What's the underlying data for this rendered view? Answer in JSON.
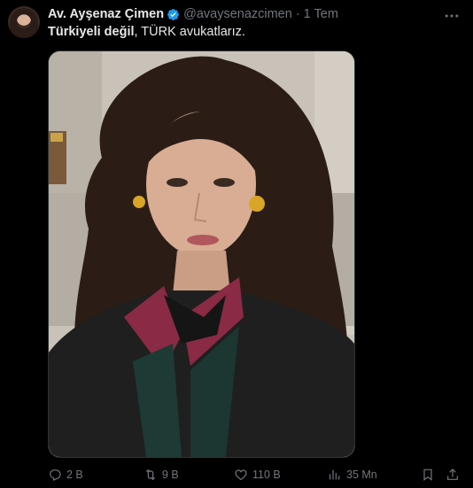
{
  "tweet": {
    "display_name": "Av. Ayşenaz Çimen",
    "handle": "@avaysenazcimen",
    "separator": "·",
    "time": "1 Tem",
    "text_bold": "Türkiyeli değil",
    "text_rest": ", TÜRK avukatlarız.",
    "verified_color": "#1d9bf0"
  },
  "actions": {
    "replies": "2 B",
    "retweets": "9 B",
    "likes": "110 B",
    "views": "35 Mn"
  },
  "icons": {
    "more": "more-horizontal-icon",
    "reply": "reply-icon",
    "retweet": "retweet-icon",
    "like": "heart-icon",
    "views": "views-chart-icon",
    "bookmark": "bookmark-icon",
    "share": "share-icon"
  }
}
